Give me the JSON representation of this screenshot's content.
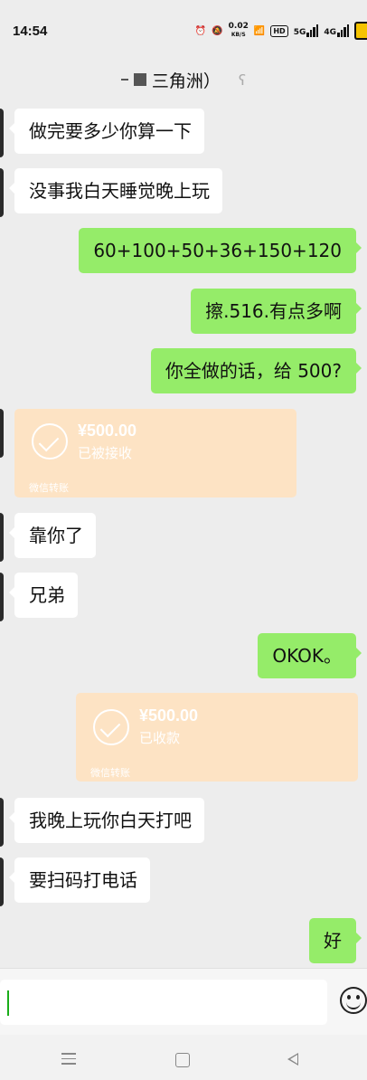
{
  "status_bar": {
    "time": "14:54",
    "net_speed": "0.02",
    "net_unit": "KB/S",
    "hd": "HD",
    "sig1": "5G",
    "sig2": "4G"
  },
  "header": {
    "title": "三角洲）"
  },
  "messages": [
    {
      "side": "left",
      "type": "text",
      "text": "做完要多少你算一下"
    },
    {
      "side": "left",
      "type": "text",
      "text": "没事我白天睡觉晚上玩"
    },
    {
      "side": "right",
      "type": "text",
      "text": "60+100+50+36+150+120"
    },
    {
      "side": "right",
      "type": "text",
      "text": "擦.516.有点多啊"
    },
    {
      "side": "right",
      "type": "text",
      "text": "你全做的话，给 500?"
    },
    {
      "side": "left",
      "type": "transfer",
      "amount": "¥500.00",
      "status": "已被接收",
      "label": "微信转账"
    },
    {
      "side": "left",
      "type": "text",
      "text": "靠你了"
    },
    {
      "side": "left",
      "type": "text",
      "text": "兄弟"
    },
    {
      "side": "right",
      "type": "text",
      "text": "OKOK。"
    },
    {
      "side": "right",
      "type": "transfer",
      "amount": "¥500.00",
      "status": "已收款",
      "label": "微信转账"
    },
    {
      "side": "left",
      "type": "text",
      "text": "我晚上玩你白天打吧"
    },
    {
      "side": "left",
      "type": "text",
      "text": "要扫码打电话"
    },
    {
      "side": "right",
      "type": "text",
      "text": "好"
    }
  ],
  "colors": {
    "sent_bubble": "#95ec69",
    "received_bubble": "#ffffff",
    "transfer_card": "#fde3c4",
    "background": "#ededed"
  }
}
